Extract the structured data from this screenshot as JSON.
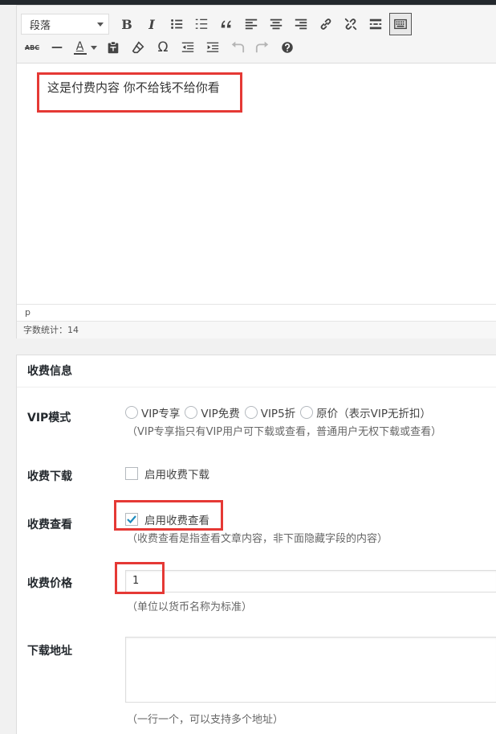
{
  "editor": {
    "format_select": "段落",
    "content_text": "这是付费内容 你不给钱不给你看",
    "status_path": "p",
    "word_count": "字数统计：14"
  },
  "icons": {
    "row1": [
      "bold-icon",
      "italic-icon",
      "bullet-list-icon",
      "numbered-list-icon",
      "blockquote-icon",
      "align-left-icon",
      "align-center-icon",
      "align-right-icon",
      "link-icon",
      "unlink-icon",
      "read-more-icon",
      "toolbar-toggle-icon"
    ],
    "row2": [
      "strikethrough-icon",
      "horizontal-rule-icon",
      "text-color-icon",
      "paste-text-icon",
      "clear-format-icon",
      "special-char-icon",
      "outdent-icon",
      "indent-icon",
      "undo-icon",
      "redo-icon",
      "help-icon"
    ]
  },
  "labels": {
    "bold": "B",
    "italic": "I",
    "strike": "ABC",
    "text_color": "A",
    "omega": "Ω"
  },
  "metabox": {
    "title": "收费信息",
    "vip": {
      "label": "VIP模式",
      "options": [
        "VIP专享",
        "VIP免费",
        "VIP5折",
        "原价（表示VIP无折扣）"
      ],
      "desc": "（VIP专享指只有VIP用户可下载或查看，普通用户无权下载或查看）"
    },
    "download": {
      "label": "收费下载",
      "checkbox_label": "启用收费下载",
      "checked": false
    },
    "view": {
      "label": "收费查看",
      "checkbox_label": "启用收费查看",
      "checked": true,
      "desc": "（收费查看是指查看文章内容，非下面隐藏字段的内容）"
    },
    "price": {
      "label": "收费价格",
      "value": "1",
      "desc": "（单位以货币名称为标准）"
    },
    "url": {
      "label": "下载地址",
      "value": "",
      "desc": "（一行一个，可以支持多个地址）"
    }
  },
  "colors": {
    "highlight": "#e53935",
    "topbar": "#23282d"
  }
}
